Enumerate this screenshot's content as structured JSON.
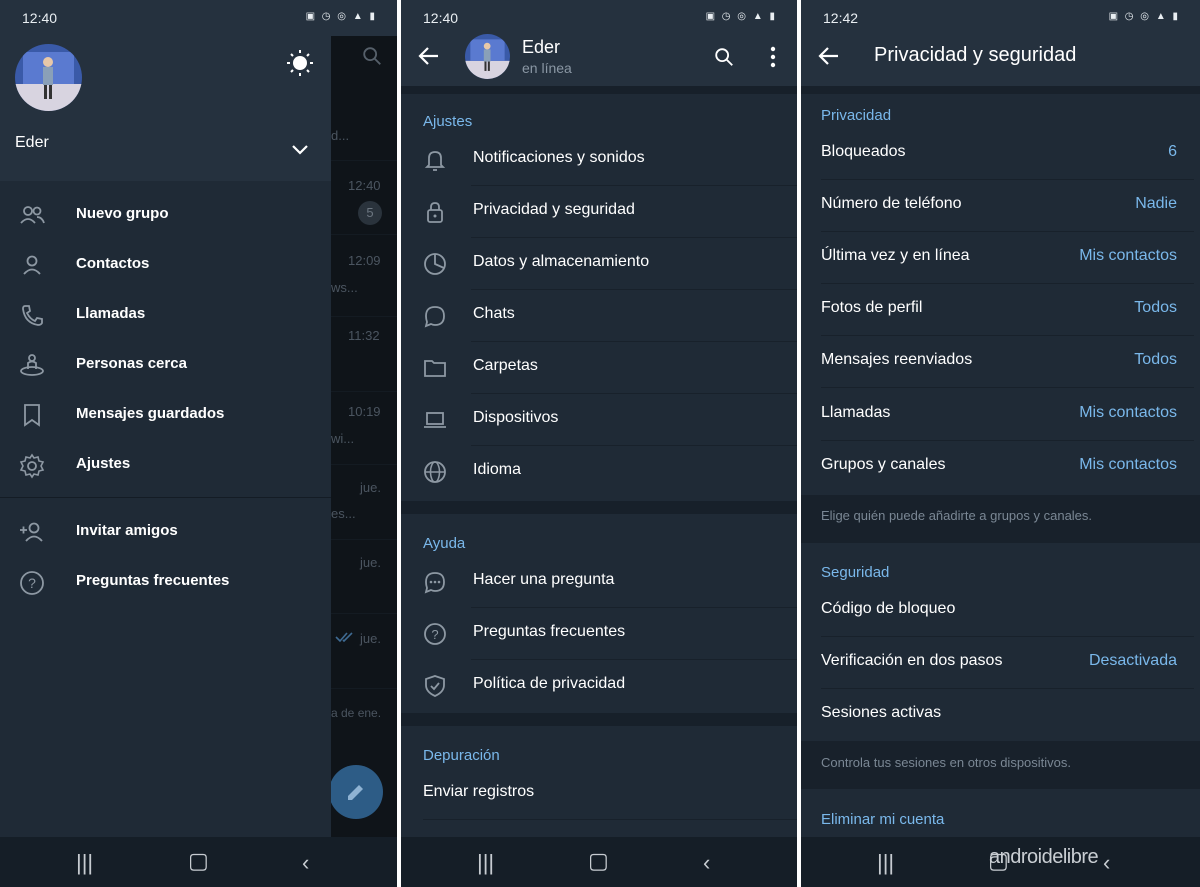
{
  "colors": {
    "background": "#1d2733",
    "header": "#25313e",
    "accent": "#7ab8eb",
    "navbar": "#151e27"
  },
  "panel1": {
    "status_time": "12:40",
    "user_name": "Eder",
    "chat_times": [
      "12:40",
      "12:09",
      "11:32",
      "10:19",
      "jue.",
      "jue.",
      "jue."
    ],
    "chat_snippets": [
      "d...",
      "ws...",
      "wi...",
      "es...",
      "a de ene."
    ],
    "unread_badge": "5",
    "menu": [
      {
        "label": "Nuevo grupo",
        "icon": "group-icon"
      },
      {
        "label": "Contactos",
        "icon": "person-icon"
      },
      {
        "label": "Llamadas",
        "icon": "phone-icon"
      },
      {
        "label": "Personas cerca",
        "icon": "nearby-people-icon"
      },
      {
        "label": "Mensajes guardados",
        "icon": "bookmark-icon"
      },
      {
        "label": "Ajustes",
        "icon": "gear-icon"
      }
    ],
    "menu2": [
      {
        "label": "Invitar amigos",
        "icon": "add-person-icon"
      },
      {
        "label": "Preguntas frecuentes",
        "icon": "help-icon"
      }
    ]
  },
  "panel2": {
    "status_time": "12:40",
    "profile_name": "Eder",
    "profile_status": "en línea",
    "sections": [
      {
        "title": "Ajustes",
        "items": [
          {
            "label": "Notificaciones y sonidos",
            "icon": "bell-icon"
          },
          {
            "label": "Privacidad y seguridad",
            "icon": "lock-icon"
          },
          {
            "label": "Datos y almacenamiento",
            "icon": "pie-chart-icon"
          },
          {
            "label": "Chats",
            "icon": "chat-bubble-icon"
          },
          {
            "label": "Carpetas",
            "icon": "folder-icon"
          },
          {
            "label": "Dispositivos",
            "icon": "laptop-icon"
          },
          {
            "label": "Idioma",
            "icon": "globe-icon"
          }
        ]
      },
      {
        "title": "Ayuda",
        "items": [
          {
            "label": "Hacer una pregunta",
            "icon": "ask-question-icon"
          },
          {
            "label": "Preguntas frecuentes",
            "icon": "help-icon"
          },
          {
            "label": "Política de privacidad",
            "icon": "shield-check-icon"
          }
        ]
      },
      {
        "title": "Depuración",
        "items": [
          {
            "label": "Enviar registros",
            "icon": ""
          }
        ]
      }
    ]
  },
  "panel3": {
    "status_time": "12:42",
    "title": "Privacidad y seguridad",
    "privacy_title": "Privacidad",
    "privacy_rows": [
      {
        "label": "Bloqueados",
        "value": "6"
      },
      {
        "label": "Número de teléfono",
        "value": "Nadie"
      },
      {
        "label": "Última vez y en línea",
        "value": "Mis contactos"
      },
      {
        "label": "Fotos de perfil",
        "value": "Todos"
      },
      {
        "label": "Mensajes reenviados",
        "value": "Todos"
      },
      {
        "label": "Llamadas",
        "value": "Mis contactos"
      },
      {
        "label": "Grupos y canales",
        "value": "Mis contactos"
      }
    ],
    "privacy_hint": "Elige quién puede añadirte a grupos y canales.",
    "security_title": "Seguridad",
    "security_rows": [
      {
        "label": "Código de bloqueo",
        "value": ""
      },
      {
        "label": "Verificación en dos pasos",
        "value": "Desactivada"
      },
      {
        "label": "Sesiones activas",
        "value": ""
      }
    ],
    "security_hint": "Controla tus sesiones en otros dispositivos.",
    "delete_title": "Eliminar mi cuenta"
  },
  "watermark": "androidelibre"
}
